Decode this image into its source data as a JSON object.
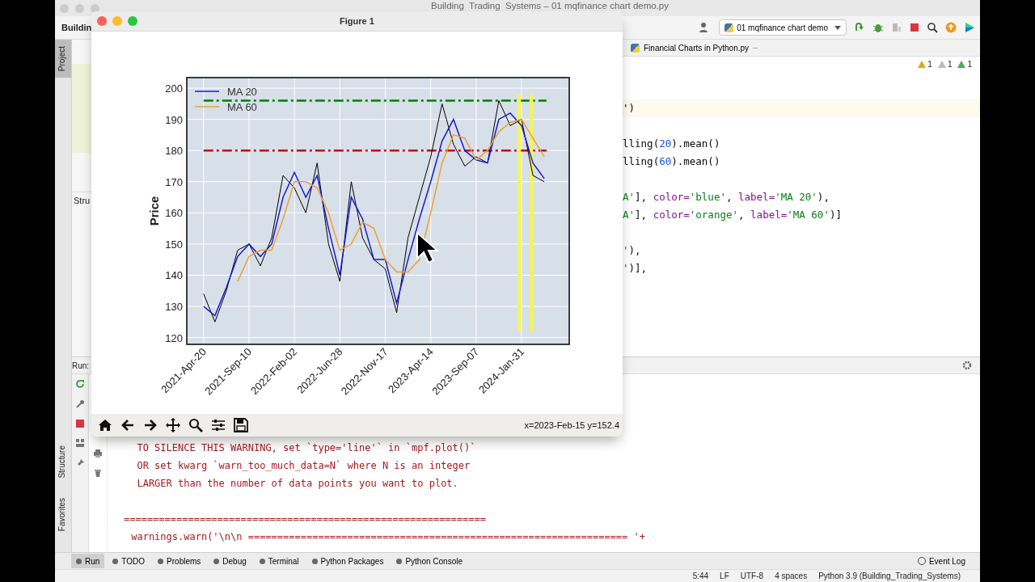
{
  "window": {
    "title": "Building  Trading  Systems – 01 mqfinance chart demo.py"
  },
  "toolbar": {
    "project": "Buildin",
    "run_config": "01 mqfinance chart demo"
  },
  "side_tabs": [
    {
      "label": "Project",
      "selected": true
    },
    {
      "label": "Structure",
      "selected": false
    },
    {
      "label": "Favorites",
      "selected": false
    }
  ],
  "structure_panel": {
    "title": "Stru"
  },
  "editor": {
    "tab": "Financial Charts in Python.py",
    "inspections": [
      "1",
      "1",
      "1"
    ],
    "blocks": [
      [
        {
          "highlighted": true,
          "segments": [
            {
              "text": "')",
              "kind": "plain"
            }
          ]
        }
      ],
      [
        {
          "highlighted": false,
          "segments": [
            {
              "text": "lling(",
              "kind": "plain"
            },
            {
              "text": "20",
              "kind": "number"
            },
            {
              "text": ").mean()",
              "kind": "plain"
            }
          ]
        },
        {
          "highlighted": false,
          "segments": [
            {
              "text": "lling(",
              "kind": "plain"
            },
            {
              "text": "60",
              "kind": "number"
            },
            {
              "text": ").mean()",
              "kind": "plain"
            }
          ]
        }
      ],
      [
        {
          "highlighted": false,
          "segments": [
            {
              "text": "A'",
              "kind": "string"
            },
            {
              "text": "], ",
              "kind": "plain"
            },
            {
              "text": "color=",
              "kind": "keyword"
            },
            {
              "text": "'blue'",
              "kind": "string"
            },
            {
              "text": ", ",
              "kind": "plain"
            },
            {
              "text": "label=",
              "kind": "keyword"
            },
            {
              "text": "'MA 20'",
              "kind": "string"
            },
            {
              "text": "),",
              "kind": "plain"
            }
          ]
        },
        {
          "highlighted": false,
          "segments": [
            {
              "text": "A'",
              "kind": "string"
            },
            {
              "text": "], ",
              "kind": "plain"
            },
            {
              "text": "color=",
              "kind": "keyword"
            },
            {
              "text": "'orange'",
              "kind": "string"
            },
            {
              "text": ", ",
              "kind": "plain"
            },
            {
              "text": "label=",
              "kind": "keyword"
            },
            {
              "text": "'MA 60'",
              "kind": "string"
            },
            {
              "text": ")]",
              "kind": "plain"
            }
          ]
        }
      ],
      [
        {
          "highlighted": false,
          "segments": [
            {
              "text": "'",
              "kind": "string"
            },
            {
              "text": "),",
              "kind": "plain"
            }
          ]
        },
        {
          "highlighted": false,
          "segments": [
            {
              "text": "'",
              "kind": "string"
            },
            {
              "text": ")],",
              "kind": "plain"
            }
          ]
        }
      ]
    ]
  },
  "run_panel": {
    "label": "Run:",
    "console": [
      "  TO SILENCE THIS WARNING, set `type='line'` in `mpf.plot()`",
      "  OR set kwarg `warn_too_much_data=N` where N is an integer",
      "  LARGER than the number of data points you want to plot.",
      "==============================================================",
      " warnings.warn('\\n\\n ================================================================= '+"
    ]
  },
  "tool_tabs": [
    {
      "label": "Run",
      "selected": true
    },
    {
      "label": "TODO",
      "selected": false
    },
    {
      "label": "Problems",
      "selected": false
    },
    {
      "label": "Debug",
      "selected": false
    },
    {
      "label": "Terminal",
      "selected": false
    },
    {
      "label": "Python Packages",
      "selected": false
    },
    {
      "label": "Python Console",
      "selected": false
    }
  ],
  "event_log": "Event Log",
  "status_bar": {
    "items": [
      "5:44",
      "LF",
      "UTF-8",
      "4 spaces",
      "Python 3.9 (Building_Trading_Systems)"
    ]
  },
  "figure": {
    "title": "Figure 1",
    "coords": "x=2023-Feb-15 y=152.4",
    "chart_data": {
      "type": "line",
      "ylabel": "Price",
      "categories": [
        "2021-Apr-20",
        null,
        null,
        null,
        "2021-Sep-10",
        null,
        null,
        null,
        "2022-Feb-02",
        null,
        null,
        null,
        "2022-Jun-28",
        null,
        null,
        null,
        "2022-Nov-17",
        null,
        null,
        null,
        "2023-Apr-14",
        null,
        null,
        null,
        "2023-Sep-07",
        null,
        null,
        null,
        "2024-Jan-31",
        null,
        null
      ],
      "series": [
        {
          "color": "#000000",
          "values": [
            134,
            125,
            135,
            148,
            150,
            143,
            152,
            172,
            168,
            160,
            176,
            150,
            138,
            170,
            152,
            145,
            142,
            128,
            152,
            165,
            178,
            195,
            182,
            175,
            178,
            176,
            196,
            188,
            190,
            172,
            170
          ]
        },
        {
          "name": "MA 20",
          "color": "#1a1acc",
          "values": [
            130,
            127,
            136,
            146,
            150,
            146,
            150,
            165,
            173,
            165,
            172,
            155,
            140,
            165,
            158,
            145,
            145,
            131,
            145,
            158,
            170,
            183,
            190,
            180,
            177,
            176,
            190,
            192,
            188,
            176,
            171
          ]
        },
        {
          "name": "MA 60",
          "color": "#f0a030",
          "values": [
            null,
            null,
            null,
            138,
            146,
            148,
            148,
            158,
            170,
            170,
            168,
            160,
            148,
            150,
            157,
            155,
            145,
            141,
            141,
            145,
            160,
            176,
            185,
            184,
            177,
            180,
            186,
            189,
            190,
            184,
            178
          ]
        }
      ],
      "ylim": [
        117.8,
        203.4
      ],
      "yticks": [
        120,
        130,
        140,
        150,
        160,
        170,
        180,
        190,
        200
      ],
      "grid": true,
      "legend": "upper left",
      "ref_lines": [
        {
          "axis": "y",
          "value": 196,
          "color": "#008000"
        },
        {
          "axis": "y",
          "value": 180,
          "color": "#cc0000"
        }
      ]
    }
  }
}
